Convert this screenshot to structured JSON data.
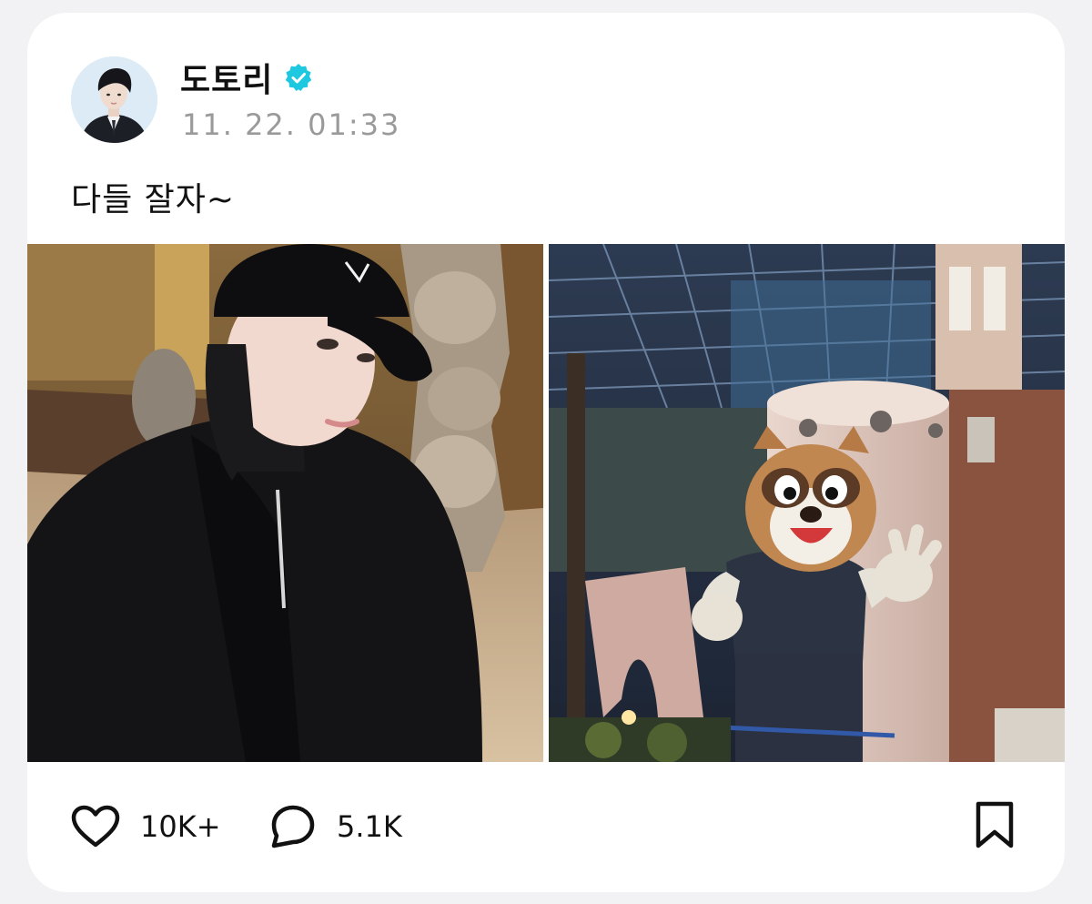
{
  "post": {
    "author": {
      "name": "도토리",
      "verified": true,
      "avatar_icon": "profile-avatar"
    },
    "timestamp": "11. 22. 01:33",
    "text": "다들 잘자~",
    "photos": [
      {
        "icon": "selfie-photo"
      },
      {
        "icon": "mascot-photo"
      }
    ]
  },
  "footer": {
    "likes": "10K+",
    "comments": "5.1K",
    "like_icon": "heart-icon",
    "comment_icon": "speech-bubble-icon",
    "bookmark_icon": "bookmark-icon"
  },
  "colors": {
    "background": "#f2f2f4",
    "card": "#ffffff",
    "verified_badge": "#1ec8e0",
    "timestamp": "#9a9a9a",
    "text": "#111111"
  }
}
